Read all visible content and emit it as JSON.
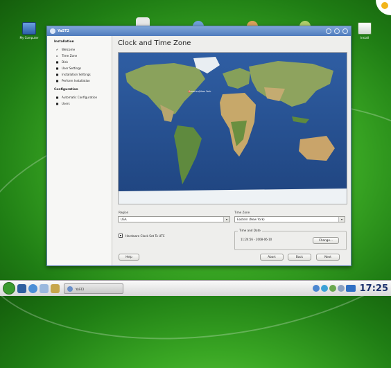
{
  "desktop": {
    "icons": [
      {
        "label": "My Computer"
      },
      {
        "label": "Install"
      }
    ]
  },
  "window": {
    "title": "YaST2"
  },
  "sidebar": {
    "sections": [
      {
        "heading": "Installation",
        "items": [
          {
            "label": "Welcome",
            "state": "done"
          },
          {
            "label": "Time Zone",
            "state": "current"
          },
          {
            "label": "Disk",
            "state": "todo"
          },
          {
            "label": "User Settings",
            "state": "todo"
          },
          {
            "label": "Installation Settings",
            "state": "todo"
          },
          {
            "label": "Perform Installation",
            "state": "todo"
          }
        ]
      },
      {
        "heading": "Configuration",
        "items": [
          {
            "label": "Automatic Configuration",
            "state": "todo"
          },
          {
            "label": "Users",
            "state": "todo"
          }
        ]
      }
    ]
  },
  "main": {
    "title": "Clock and Time Zone",
    "map_city_label": "America/New York",
    "region": {
      "label": "Region",
      "value": "USA"
    },
    "timezone": {
      "label": "Time Zone",
      "value": "Eastern (New York)"
    },
    "hardware_clock": {
      "label": "Hardware Clock Set To UTC",
      "checked": true
    },
    "time_date": {
      "title": "Time and Date",
      "value": "11:24:56 - 2008-06-10",
      "change_label": "Change..."
    }
  },
  "buttons": {
    "help": "Help",
    "abort": "Abort",
    "back": "Back",
    "next": "Next"
  },
  "taskbar": {
    "task_label": "YaST2",
    "clock": "17:25"
  },
  "colors": {
    "desktop_green": "#3aa724",
    "titlebar_blue": "#4f7bbd",
    "clock_text": "#1a2f6b"
  }
}
